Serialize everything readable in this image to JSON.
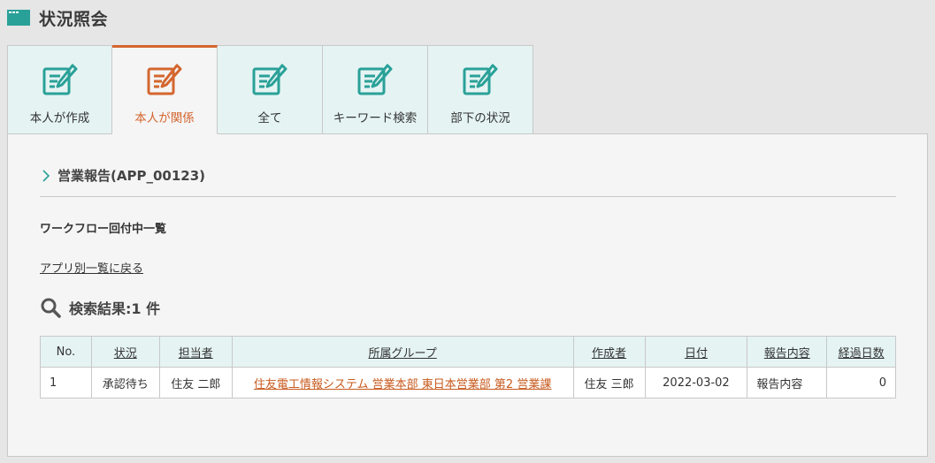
{
  "header": {
    "title": "状況照会"
  },
  "tabs": [
    {
      "label": "本人が作成"
    },
    {
      "label": "本人が関係"
    },
    {
      "label": "全て"
    },
    {
      "label": "キーワード検索"
    },
    {
      "label": "部下の状況"
    }
  ],
  "section": {
    "title": "営業報告(APP_00123)",
    "subtitle": "ワークフロー回付中一覧",
    "back_link": "アプリ別一覧に戻る",
    "result_count": "検索結果:1 件"
  },
  "table": {
    "headers": [
      "No.",
      "状況",
      "担当者",
      "所属グループ",
      "作成者",
      "日付",
      "報告内容",
      "経過日数"
    ],
    "rows": [
      {
        "no": "1",
        "status": "承認待ち",
        "owner": "住友 二郎",
        "group": "住友電工情報システム 営業本部 東日本営業部 第2 営業課",
        "author": "住友 三郎",
        "date": "2022-03-02",
        "report": "報告内容",
        "days": "0"
      }
    ]
  },
  "colors": {
    "accent": "#d4662f",
    "teal": "#2aa198",
    "tab_bg": "#e5f4f3"
  }
}
